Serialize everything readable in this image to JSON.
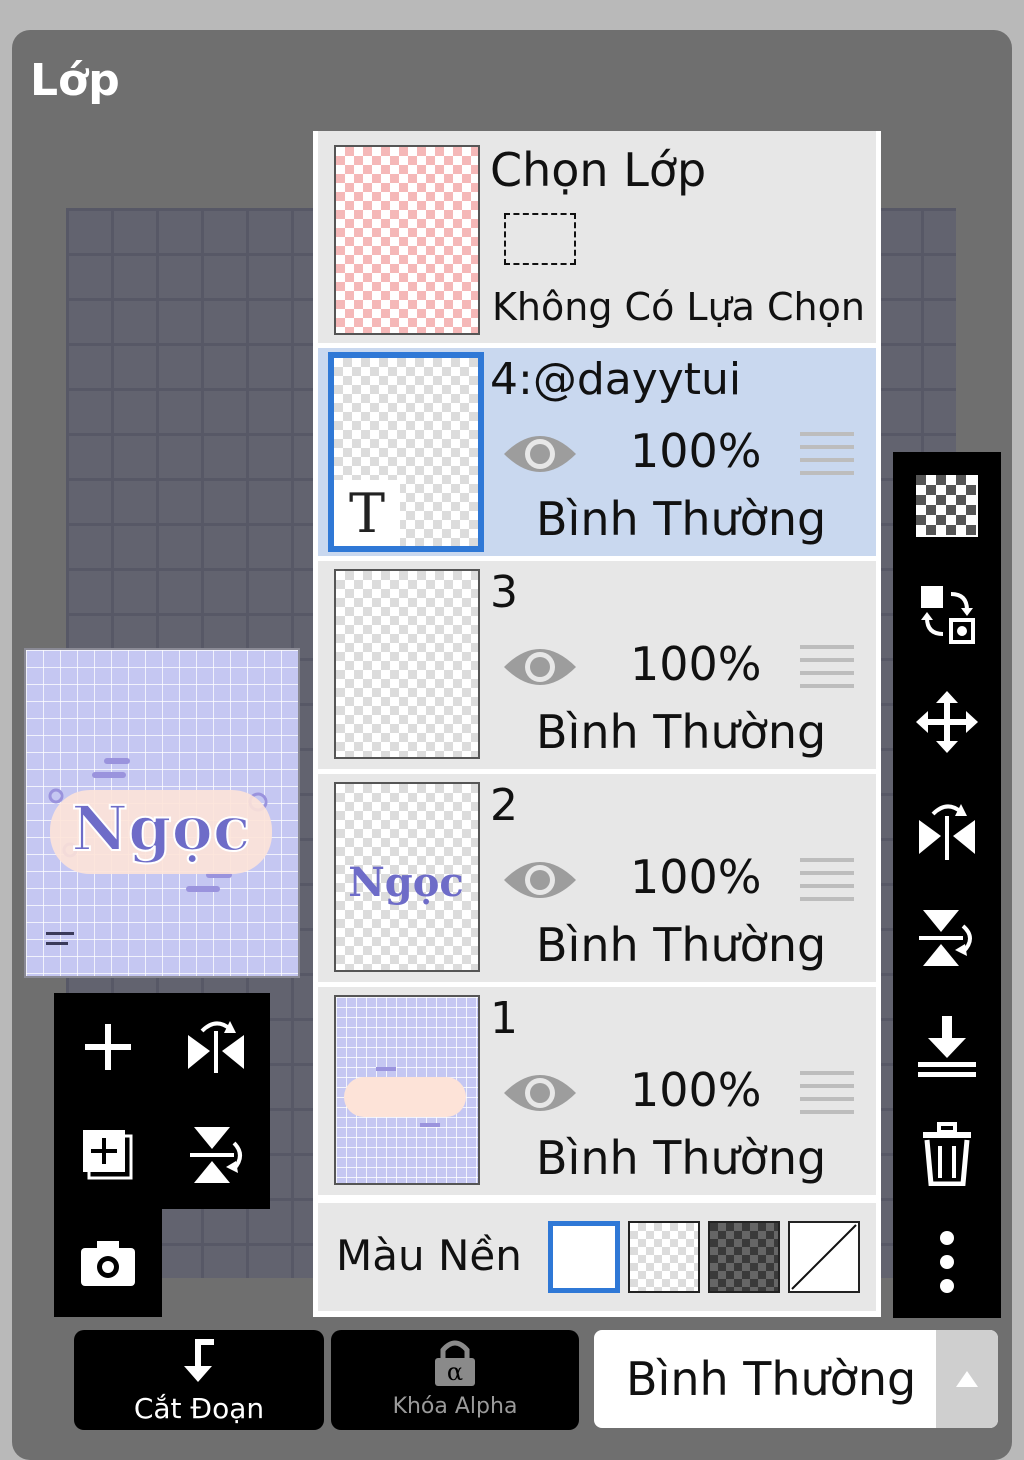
{
  "panel": {
    "title": "Lớp"
  },
  "selection_row": {
    "title": "Chọn Lớp",
    "status": "Không Có Lựa Chọn"
  },
  "layers": [
    {
      "name": "4:@dayytui",
      "opacity": "100%",
      "blend": "Bình Thường",
      "selected": true
    },
    {
      "name": "3",
      "opacity": "100%",
      "blend": "Bình Thường",
      "selected": false
    },
    {
      "name": "2",
      "opacity": "100%",
      "blend": "Bình Thường",
      "selected": false
    },
    {
      "name": "1",
      "opacity": "100%",
      "blend": "Bình Thường",
      "selected": false
    }
  ],
  "background": {
    "label": "Màu Nền",
    "selected_swatch": "white"
  },
  "preview": {
    "art_text": "Ngọc"
  },
  "bottom": {
    "clip_label": "Cắt Đoạn",
    "alpha_lock_label": "Khóa Alpha",
    "blend_mode_value": "Bình Thường"
  },
  "colors": {
    "accent": "#2f78d6",
    "selected_row": "#c9d8ef",
    "lavender": "#c5c7f2"
  }
}
